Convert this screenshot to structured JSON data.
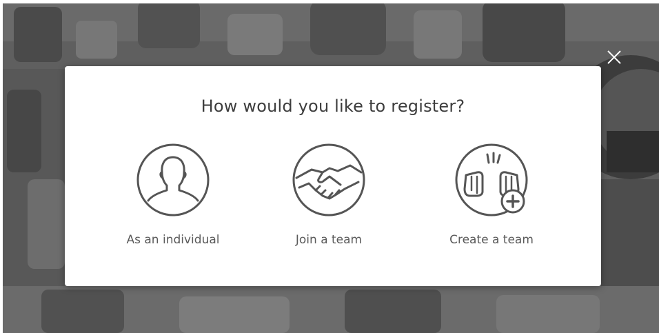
{
  "modal": {
    "title": "How would you like to register?",
    "options": [
      {
        "label": "As an individual",
        "icon": "person-icon"
      },
      {
        "label": "Join a team",
        "icon": "handshake-icon"
      },
      {
        "label": "Create a team",
        "icon": "fist-bump-plus-icon"
      }
    ]
  },
  "close": {
    "icon": "close-icon"
  },
  "colors": {
    "overlay": "#5e5e5e",
    "modal_bg": "#ffffff",
    "icon_stroke": "#555555",
    "title_text": "#3d3d3d",
    "label_text": "#5a5a5a"
  }
}
